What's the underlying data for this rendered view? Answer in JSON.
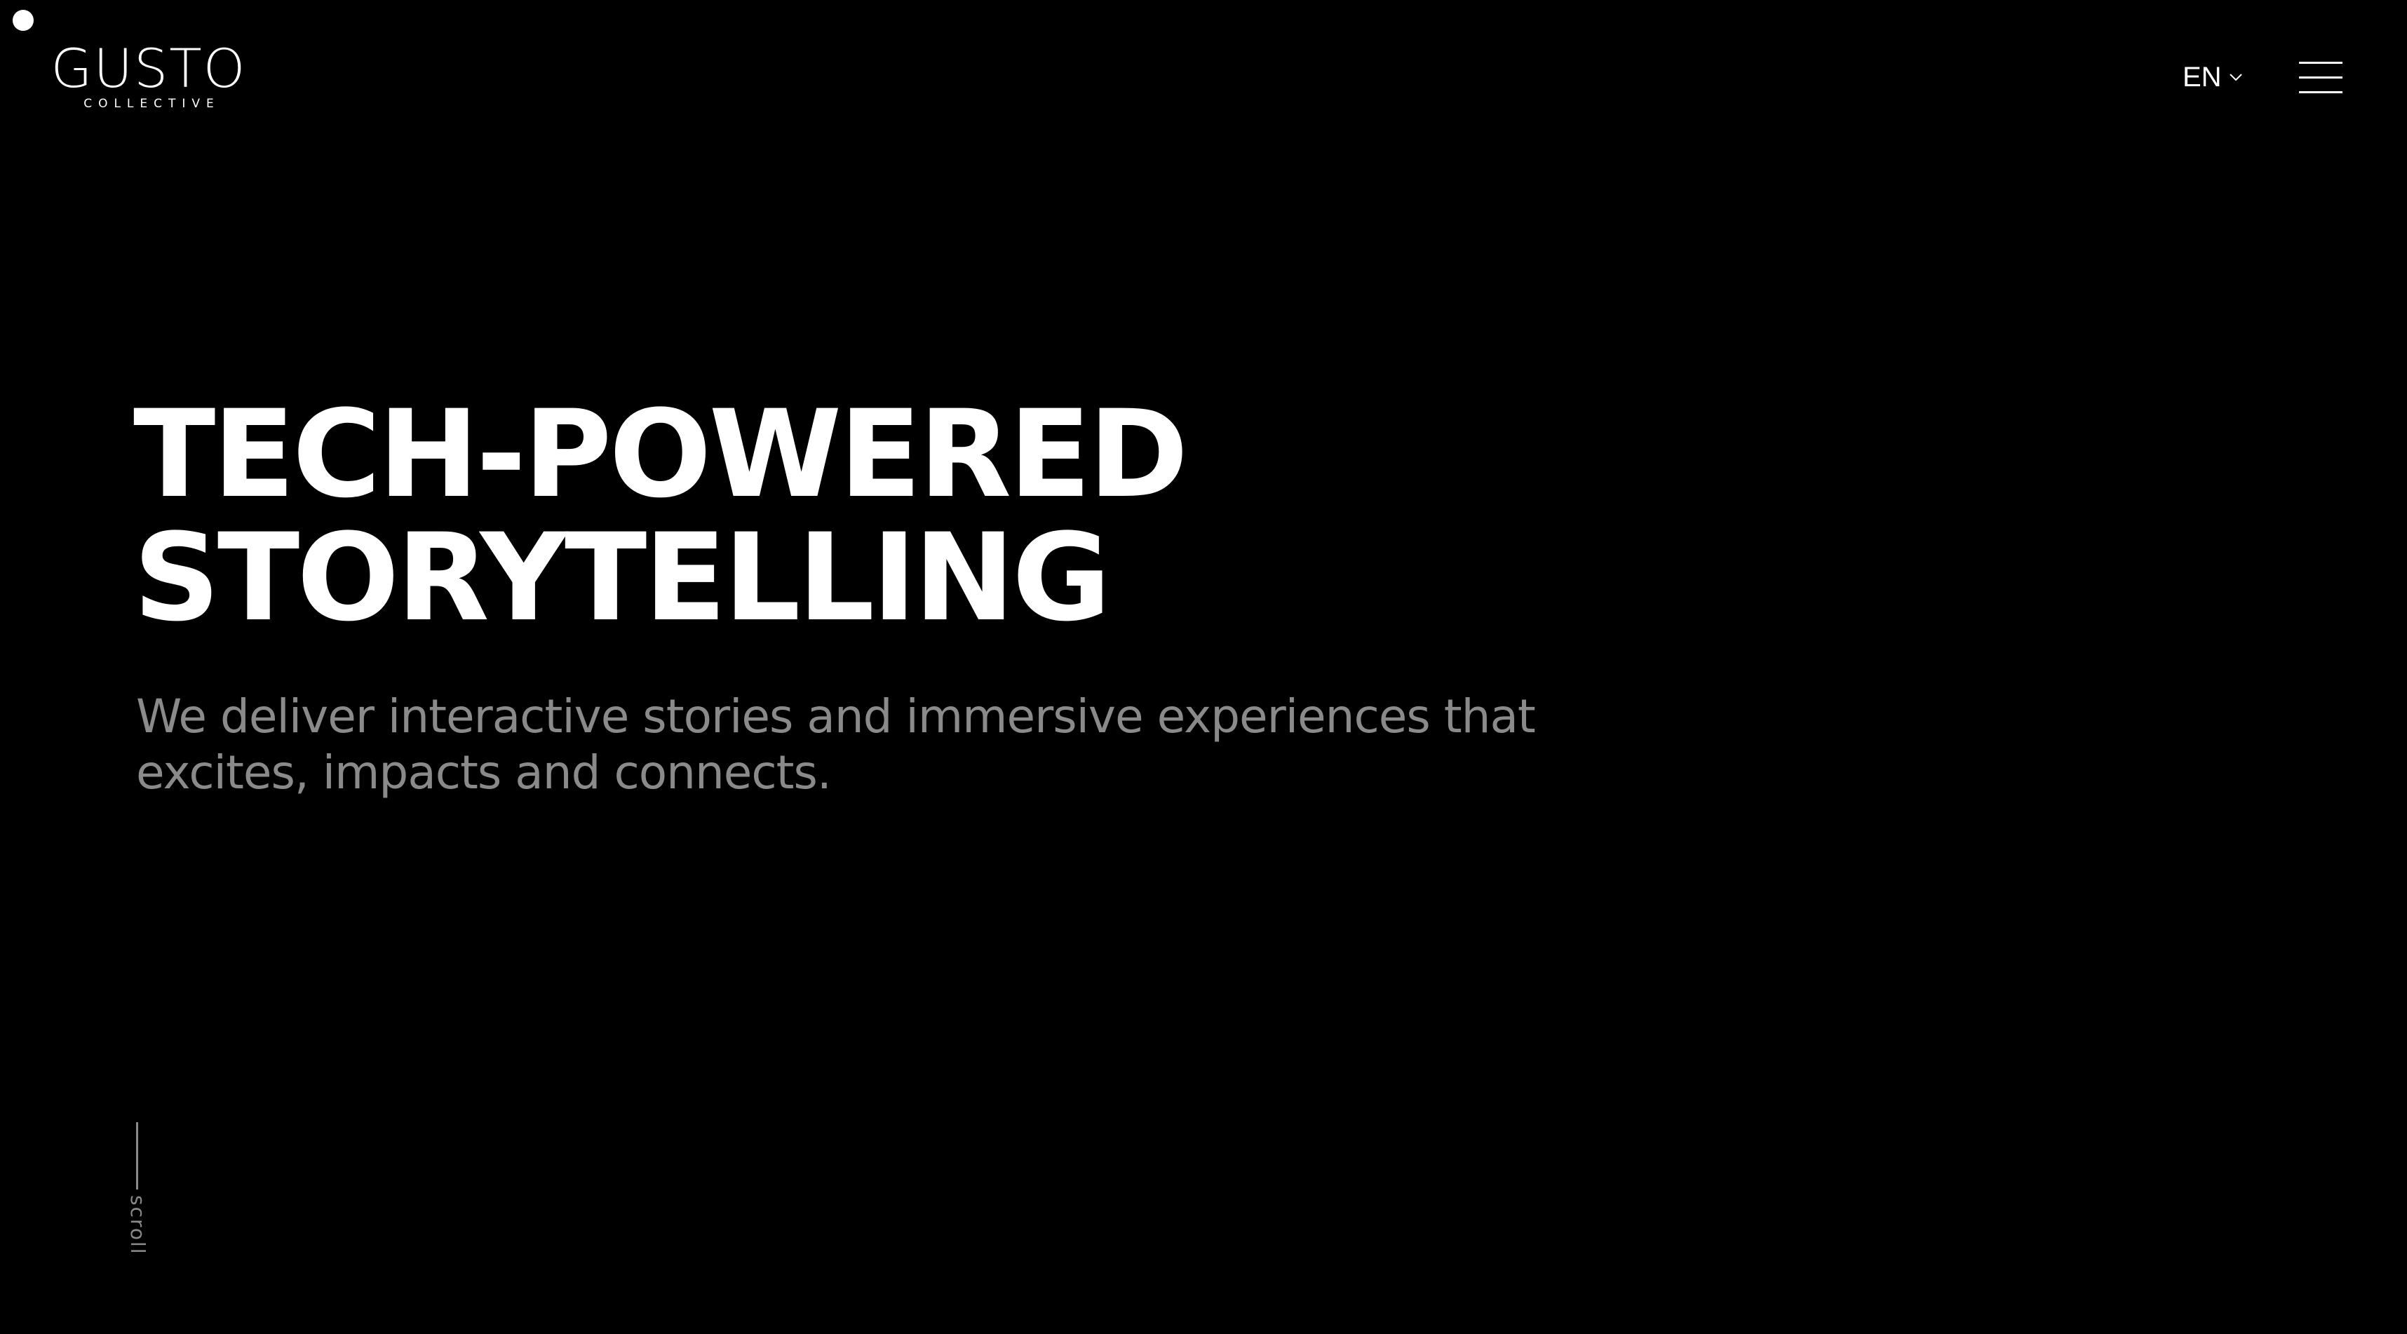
{
  "header": {
    "logo": {
      "name": "GUSTO",
      "tagline": "COLLECTIVE"
    },
    "language": {
      "selected": "EN",
      "icon": "chevron-down-icon"
    },
    "menu": {
      "icon": "hamburger-menu-icon"
    }
  },
  "hero": {
    "title_lines": [
      "TECH-POWERED",
      "STORYTELLING"
    ],
    "subtitle_lines": [
      "We deliver interactive stories and immersive experiences that",
      "excites, impacts and connects."
    ]
  },
  "scroll_indicator": {
    "label": "scroll"
  },
  "colors": {
    "background": "#000000",
    "text_primary": "#ffffff",
    "text_muted": "#8a8a8a"
  }
}
